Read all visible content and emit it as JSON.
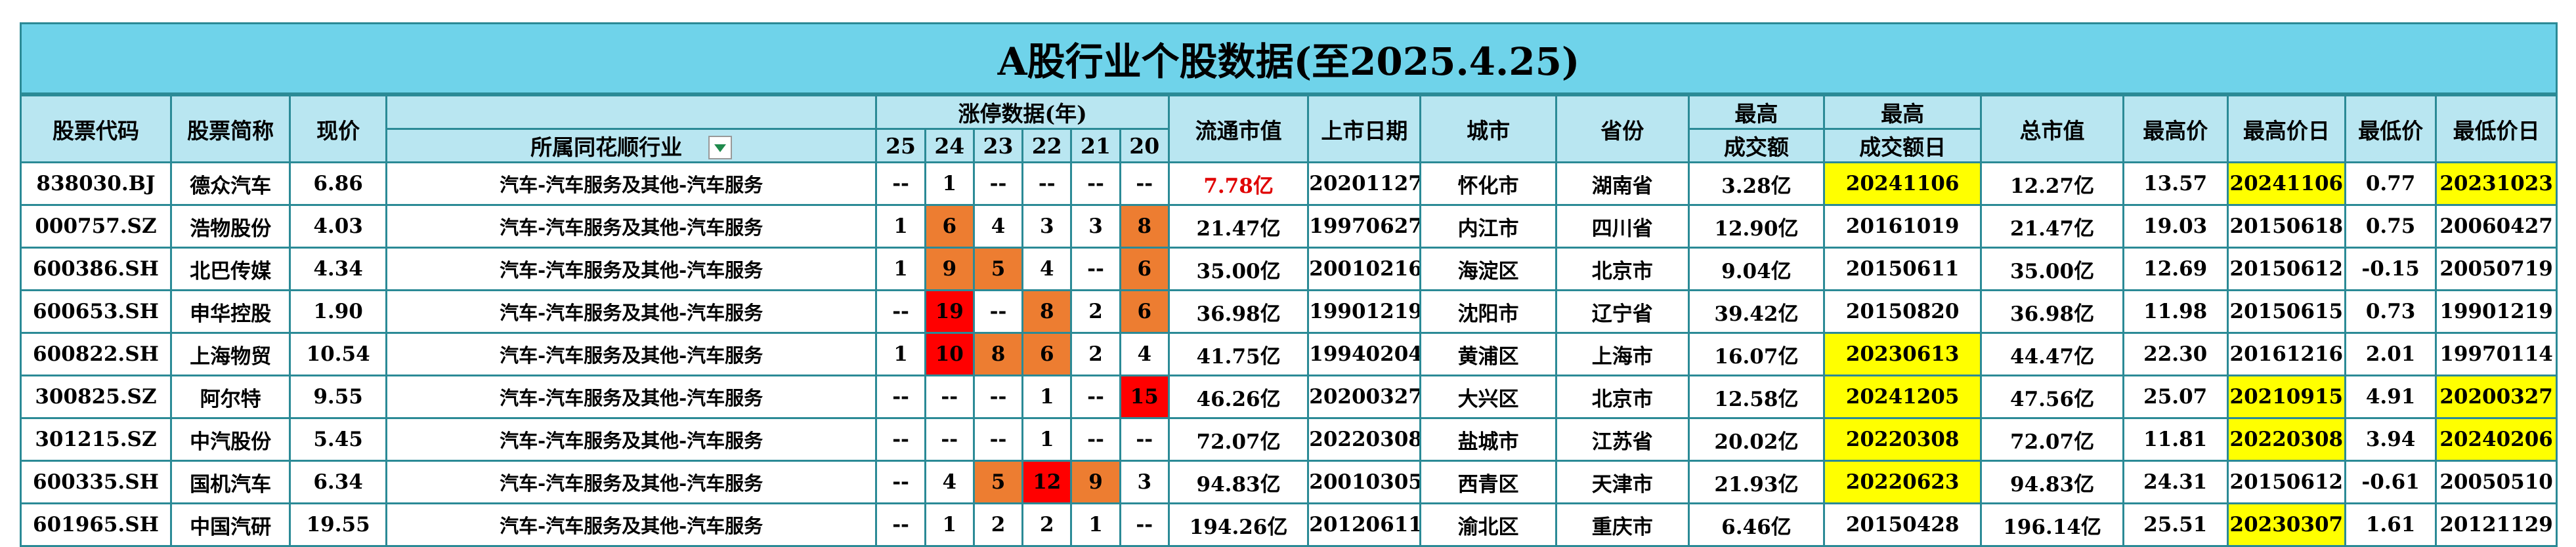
{
  "title": "A股行业个股数据(至2025.4.25)",
  "headers": {
    "code": "股票代码",
    "name": "股票简称",
    "price": "现价",
    "industry": "所属同花顺行业",
    "limit_group": "涨停数据(年)",
    "years": [
      "25",
      "24",
      "23",
      "22",
      "21",
      "20"
    ],
    "float_cap": "流通市值",
    "list_date": "上市日期",
    "city": "城市",
    "province": "省份",
    "max_turnover_top": "最高",
    "max_turnover_bottom": "成交额",
    "max_turnover_date_top": "最高",
    "max_turnover_date_bottom": "成交额日",
    "total_cap": "总市值",
    "high_price": "最高价",
    "high_date": "最高价日",
    "low_price": "最低价",
    "low_date": "最低价日"
  },
  "colors": {
    "title_bg": "#6fd3ea",
    "header_bg": "#b9e6f1",
    "border": "#2b8a96",
    "orange": "#ed7d31",
    "red": "#ff0000",
    "yellow": "#ffff00"
  },
  "rows": [
    {
      "code": "838030.BJ",
      "name": "德众汽车",
      "price": "6.86",
      "industry": "汽车-汽车服务及其他-汽车服务",
      "limits": [
        "--",
        "1",
        "--",
        "--",
        "--",
        "--"
      ],
      "float_cap": "7.78亿",
      "list_date": "20201127",
      "city": "怀化市",
      "province": "湖南省",
      "max_turnover": "3.28亿",
      "max_turnover_date": "20241106",
      "total_cap": "12.27亿",
      "high_price": "13.57",
      "high_date": "20241106",
      "low_price": "0.77",
      "low_date": "20231023"
    },
    {
      "code": "000757.SZ",
      "name": "浩物股份",
      "price": "4.03",
      "industry": "汽车-汽车服务及其他-汽车服务",
      "limits": [
        "1",
        "6",
        "4",
        "3",
        "3",
        "8"
      ],
      "float_cap": "21.47亿",
      "list_date": "19970627",
      "city": "内江市",
      "province": "四川省",
      "max_turnover": "12.90亿",
      "max_turnover_date": "20161019",
      "total_cap": "21.47亿",
      "high_price": "19.03",
      "high_date": "20150618",
      "low_price": "0.75",
      "low_date": "20060427"
    },
    {
      "code": "600386.SH",
      "name": "北巴传媒",
      "price": "4.34",
      "industry": "汽车-汽车服务及其他-汽车服务",
      "limits": [
        "1",
        "9",
        "5",
        "4",
        "--",
        "6"
      ],
      "float_cap": "35.00亿",
      "list_date": "20010216",
      "city": "海淀区",
      "province": "北京市",
      "max_turnover": "9.04亿",
      "max_turnover_date": "20150611",
      "total_cap": "35.00亿",
      "high_price": "12.69",
      "high_date": "20150612",
      "low_price": "-0.15",
      "low_date": "20050719"
    },
    {
      "code": "600653.SH",
      "name": "申华控股",
      "price": "1.90",
      "industry": "汽车-汽车服务及其他-汽车服务",
      "limits": [
        "--",
        "19",
        "--",
        "8",
        "2",
        "6"
      ],
      "float_cap": "36.98亿",
      "list_date": "19901219",
      "city": "沈阳市",
      "province": "辽宁省",
      "max_turnover": "39.42亿",
      "max_turnover_date": "20150820",
      "total_cap": "36.98亿",
      "high_price": "11.98",
      "high_date": "20150615",
      "low_price": "0.73",
      "low_date": "19901219"
    },
    {
      "code": "600822.SH",
      "name": "上海物贸",
      "price": "10.54",
      "industry": "汽车-汽车服务及其他-汽车服务",
      "limits": [
        "1",
        "10",
        "8",
        "6",
        "2",
        "4"
      ],
      "float_cap": "41.75亿",
      "list_date": "19940204",
      "city": "黄浦区",
      "province": "上海市",
      "max_turnover": "16.07亿",
      "max_turnover_date": "20230613",
      "total_cap": "44.47亿",
      "high_price": "22.30",
      "high_date": "20161216",
      "low_price": "2.01",
      "low_date": "19970114"
    },
    {
      "code": "300825.SZ",
      "name": "阿尔特",
      "price": "9.55",
      "industry": "汽车-汽车服务及其他-汽车服务",
      "limits": [
        "--",
        "--",
        "--",
        "1",
        "--",
        "15"
      ],
      "float_cap": "46.26亿",
      "list_date": "20200327",
      "city": "大兴区",
      "province": "北京市",
      "max_turnover": "12.58亿",
      "max_turnover_date": "20241205",
      "total_cap": "47.56亿",
      "high_price": "25.07",
      "high_date": "20210915",
      "low_price": "4.91",
      "low_date": "20200327"
    },
    {
      "code": "301215.SZ",
      "name": "中汽股份",
      "price": "5.45",
      "industry": "汽车-汽车服务及其他-汽车服务",
      "limits": [
        "--",
        "--",
        "--",
        "1",
        "--",
        "--"
      ],
      "float_cap": "72.07亿",
      "list_date": "20220308",
      "city": "盐城市",
      "province": "江苏省",
      "max_turnover": "20.02亿",
      "max_turnover_date": "20220308",
      "total_cap": "72.07亿",
      "high_price": "11.81",
      "high_date": "20220308",
      "low_price": "3.94",
      "low_date": "20240206"
    },
    {
      "code": "600335.SH",
      "name": "国机汽车",
      "price": "6.34",
      "industry": "汽车-汽车服务及其他-汽车服务",
      "limits": [
        "--",
        "4",
        "5",
        "12",
        "9",
        "3"
      ],
      "float_cap": "94.83亿",
      "list_date": "20010305",
      "city": "西青区",
      "province": "天津市",
      "max_turnover": "21.93亿",
      "max_turnover_date": "20220623",
      "total_cap": "94.83亿",
      "high_price": "24.31",
      "high_date": "20150612",
      "low_price": "-0.61",
      "low_date": "20050510"
    },
    {
      "code": "601965.SH",
      "name": "中国汽研",
      "price": "19.55",
      "industry": "汽车-汽车服务及其他-汽车服务",
      "limits": [
        "--",
        "1",
        "2",
        "2",
        "1",
        "--"
      ],
      "float_cap": "194.26亿",
      "list_date": "20120611",
      "city": "渝北区",
      "province": "重庆市",
      "max_turnover": "6.46亿",
      "max_turnover_date": "20150428",
      "total_cap": "196.14亿",
      "high_price": "25.51",
      "high_date": "20230307",
      "low_price": "1.61",
      "low_date": "20121129"
    }
  ],
  "highlights": {
    "float_cap_red_rows": [
      0
    ],
    "max_turnover_date_yellow_rows": [
      0,
      4,
      5,
      6,
      7
    ],
    "high_date_yellow_rows": [
      0,
      5,
      6,
      8
    ],
    "low_date_yellow_rows": [
      0,
      5,
      6
    ],
    "limit_cells": [
      {
        "row": 1,
        "col": 1,
        "color": "orange"
      },
      {
        "row": 1,
        "col": 5,
        "color": "orange"
      },
      {
        "row": 2,
        "col": 1,
        "color": "orange"
      },
      {
        "row": 2,
        "col": 2,
        "color": "orange"
      },
      {
        "row": 2,
        "col": 5,
        "color": "orange"
      },
      {
        "row": 3,
        "col": 1,
        "color": "red"
      },
      {
        "row": 3,
        "col": 3,
        "color": "orange"
      },
      {
        "row": 3,
        "col": 5,
        "color": "orange"
      },
      {
        "row": 4,
        "col": 1,
        "color": "red"
      },
      {
        "row": 4,
        "col": 2,
        "color": "orange"
      },
      {
        "row": 4,
        "col": 3,
        "color": "orange"
      },
      {
        "row": 5,
        "col": 5,
        "color": "red"
      },
      {
        "row": 7,
        "col": 2,
        "color": "orange"
      },
      {
        "row": 7,
        "col": 3,
        "color": "red"
      },
      {
        "row": 7,
        "col": 4,
        "color": "orange"
      }
    ]
  }
}
